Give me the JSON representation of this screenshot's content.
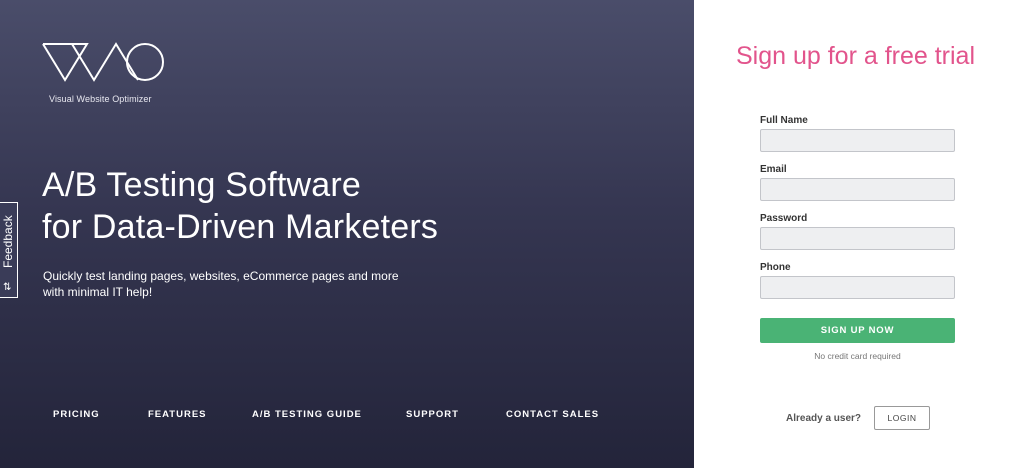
{
  "brand": {
    "logo_icon": "vwo-logo-icon",
    "tagline": "Visual Website Optimizer"
  },
  "hero": {
    "headline_line1": "A/B Testing Software",
    "headline_line2": "for Data-Driven Marketers",
    "subtext_line1": "Quickly test landing pages, websites, eCommerce pages and more",
    "subtext_line2": "with minimal IT help!"
  },
  "nav": {
    "items": [
      {
        "label": "PRICING"
      },
      {
        "label": "FEATURES"
      },
      {
        "label": "A/B TESTING GUIDE"
      },
      {
        "label": "SUPPORT"
      },
      {
        "label": "CONTACT SALES"
      }
    ]
  },
  "feedback": {
    "label": "Feedback",
    "icon": "sliders-icon"
  },
  "form": {
    "title": "Sign up for a free trial",
    "fields": [
      {
        "label": "Full Name",
        "value": "",
        "placeholder": ""
      },
      {
        "label": "Email",
        "value": "",
        "placeholder": ""
      },
      {
        "label": "Password",
        "value": "",
        "placeholder": ""
      },
      {
        "label": "Phone",
        "value": "",
        "placeholder": ""
      }
    ],
    "submit_label": "SIGN UP NOW",
    "note": "No credit card required",
    "already_user": "Already a user?",
    "login_label": "LOGIN"
  },
  "colors": {
    "accent_pink": "#e2548c",
    "cta_green": "#4ab375",
    "hero_bg_top": "#4a4d6a",
    "hero_bg_bottom": "#23243a"
  }
}
